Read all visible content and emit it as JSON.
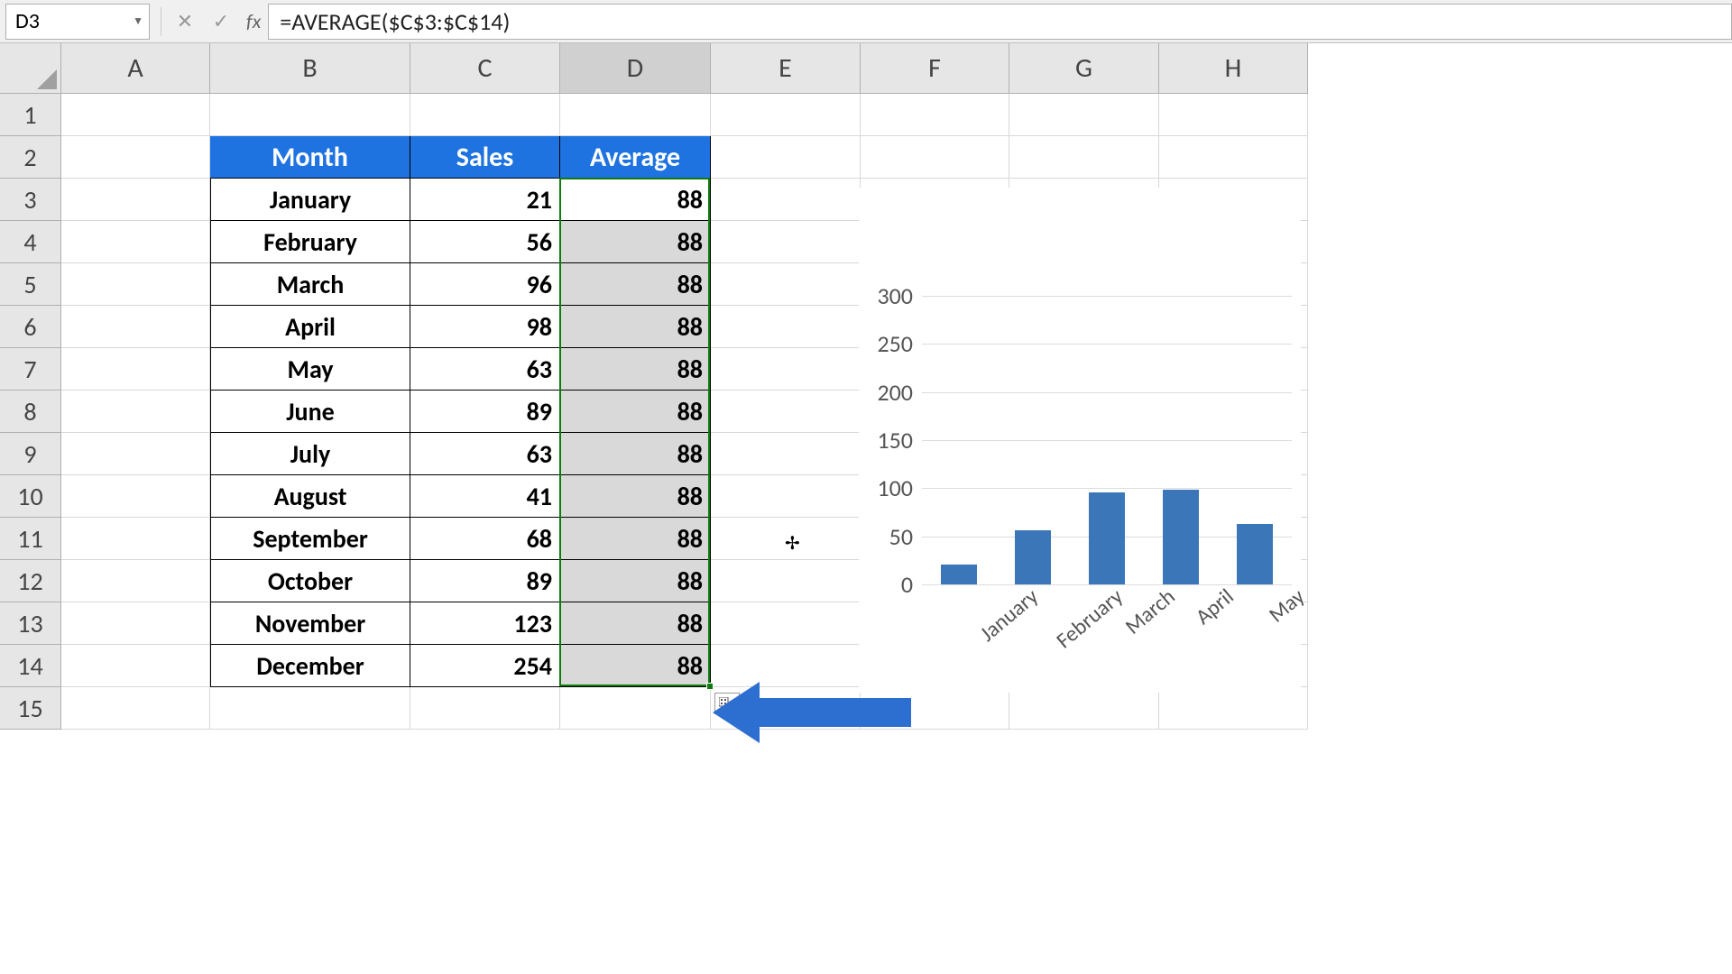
{
  "formula_bar": {
    "name_box": "D3",
    "fx_label": "fx",
    "formula": "=AVERAGE($C$3:$C$14)"
  },
  "columns": [
    "A",
    "B",
    "C",
    "D",
    "E",
    "F",
    "G",
    "H"
  ],
  "column_widths": {
    "A": 165,
    "B": 222,
    "C": 166,
    "D": 167,
    "E": 166,
    "F": 165,
    "G": 166,
    "H": 165
  },
  "rows": [
    "1",
    "2",
    "3",
    "4",
    "5",
    "6",
    "7",
    "8",
    "9",
    "10",
    "11",
    "12",
    "13",
    "14",
    "15"
  ],
  "selected_column": "D",
  "table": {
    "headers": {
      "B": "Month",
      "C": "Sales",
      "D": "Average"
    },
    "data": [
      {
        "month": "January",
        "sales": 21,
        "average": 88
      },
      {
        "month": "February",
        "sales": 56,
        "average": 88
      },
      {
        "month": "March",
        "sales": 96,
        "average": 88
      },
      {
        "month": "April",
        "sales": 98,
        "average": 88
      },
      {
        "month": "May",
        "sales": 63,
        "average": 88
      },
      {
        "month": "June",
        "sales": 89,
        "average": 88
      },
      {
        "month": "July",
        "sales": 63,
        "average": 88
      },
      {
        "month": "August",
        "sales": 41,
        "average": 88
      },
      {
        "month": "September",
        "sales": 68,
        "average": 88
      },
      {
        "month": "October",
        "sales": 89,
        "average": 88
      },
      {
        "month": "November",
        "sales": 123,
        "average": 88
      },
      {
        "month": "December",
        "sales": 254,
        "average": 88
      }
    ]
  },
  "chart_data": {
    "type": "bar",
    "categories": [
      "January",
      "February",
      "March",
      "April",
      "May"
    ],
    "values": [
      21,
      56,
      96,
      98,
      63
    ],
    "title": "",
    "xlabel": "",
    "ylabel": "",
    "ylim": [
      0,
      300
    ],
    "yticks": [
      0,
      50,
      100,
      150,
      200,
      250,
      300
    ]
  },
  "selection": {
    "col": "D",
    "row_start": 3,
    "row_end": 14
  }
}
